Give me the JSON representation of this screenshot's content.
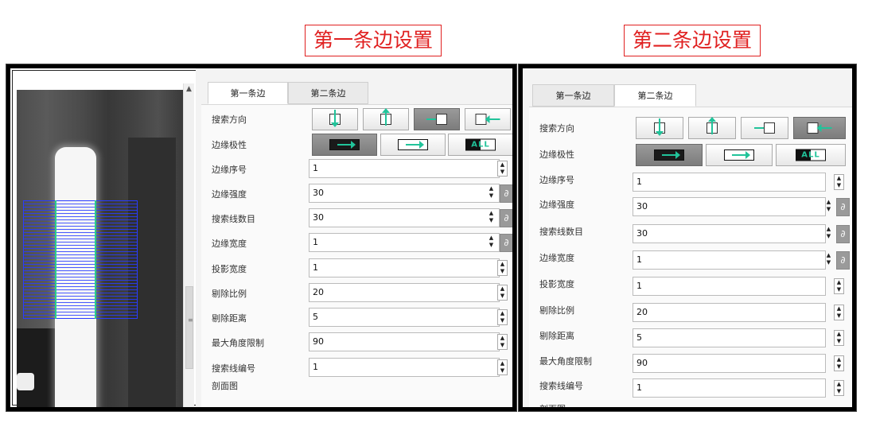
{
  "captions": {
    "first": "第一条边设置",
    "second": "第二条边设置"
  },
  "colors": {
    "caption_red": "#e02020",
    "arrow_teal": "#21c39a",
    "grid_blue": "#2a3cff",
    "edge_green": "#2ad08a"
  },
  "tabs": {
    "tab1": "第一条边",
    "tab2": "第二条边"
  },
  "labels": {
    "search_direction": "搜索方向",
    "edge_polarity": "边缘极性",
    "edge_index": "边缘序号",
    "edge_strength": "边缘强度",
    "search_line_count": "搜索线数目",
    "edge_width": "边缘宽度",
    "projection_width": "投影宽度",
    "reject_ratio": "剔除比例",
    "reject_distance": "剔除距离",
    "max_angle_limit": "最大角度限制",
    "search_line_number": "搜索线编号",
    "profile": "剖面图"
  },
  "polarity_all_label": "ALL",
  "icons": {
    "spinner": "up-down-spinner-icon",
    "link": "link-icon",
    "dir_down": "arrow-down-in-box-icon",
    "dir_up": "arrow-up-in-box-icon",
    "dir_right": "arrow-right-in-box-icon",
    "dir_left": "arrow-left-in-box-icon"
  },
  "panel1": {
    "active_tab": "tab1",
    "selected_direction": "right",
    "selected_polarity": "dark_to_light",
    "values": {
      "edge_index": "1",
      "edge_strength": "30",
      "search_line_count": "30",
      "edge_width": "1",
      "projection_width": "1",
      "reject_ratio": "20",
      "reject_distance": "5",
      "max_angle_limit": "90",
      "search_line_number": "1"
    }
  },
  "panel2": {
    "active_tab": "tab2",
    "selected_direction": "left",
    "selected_polarity": "dark_to_light",
    "values": {
      "edge_index": "1",
      "edge_strength": "30",
      "search_line_count": "30",
      "edge_width": "1",
      "projection_width": "1",
      "reject_ratio": "20",
      "reject_distance": "5",
      "max_angle_limit": "90",
      "search_line_number": "1"
    }
  }
}
